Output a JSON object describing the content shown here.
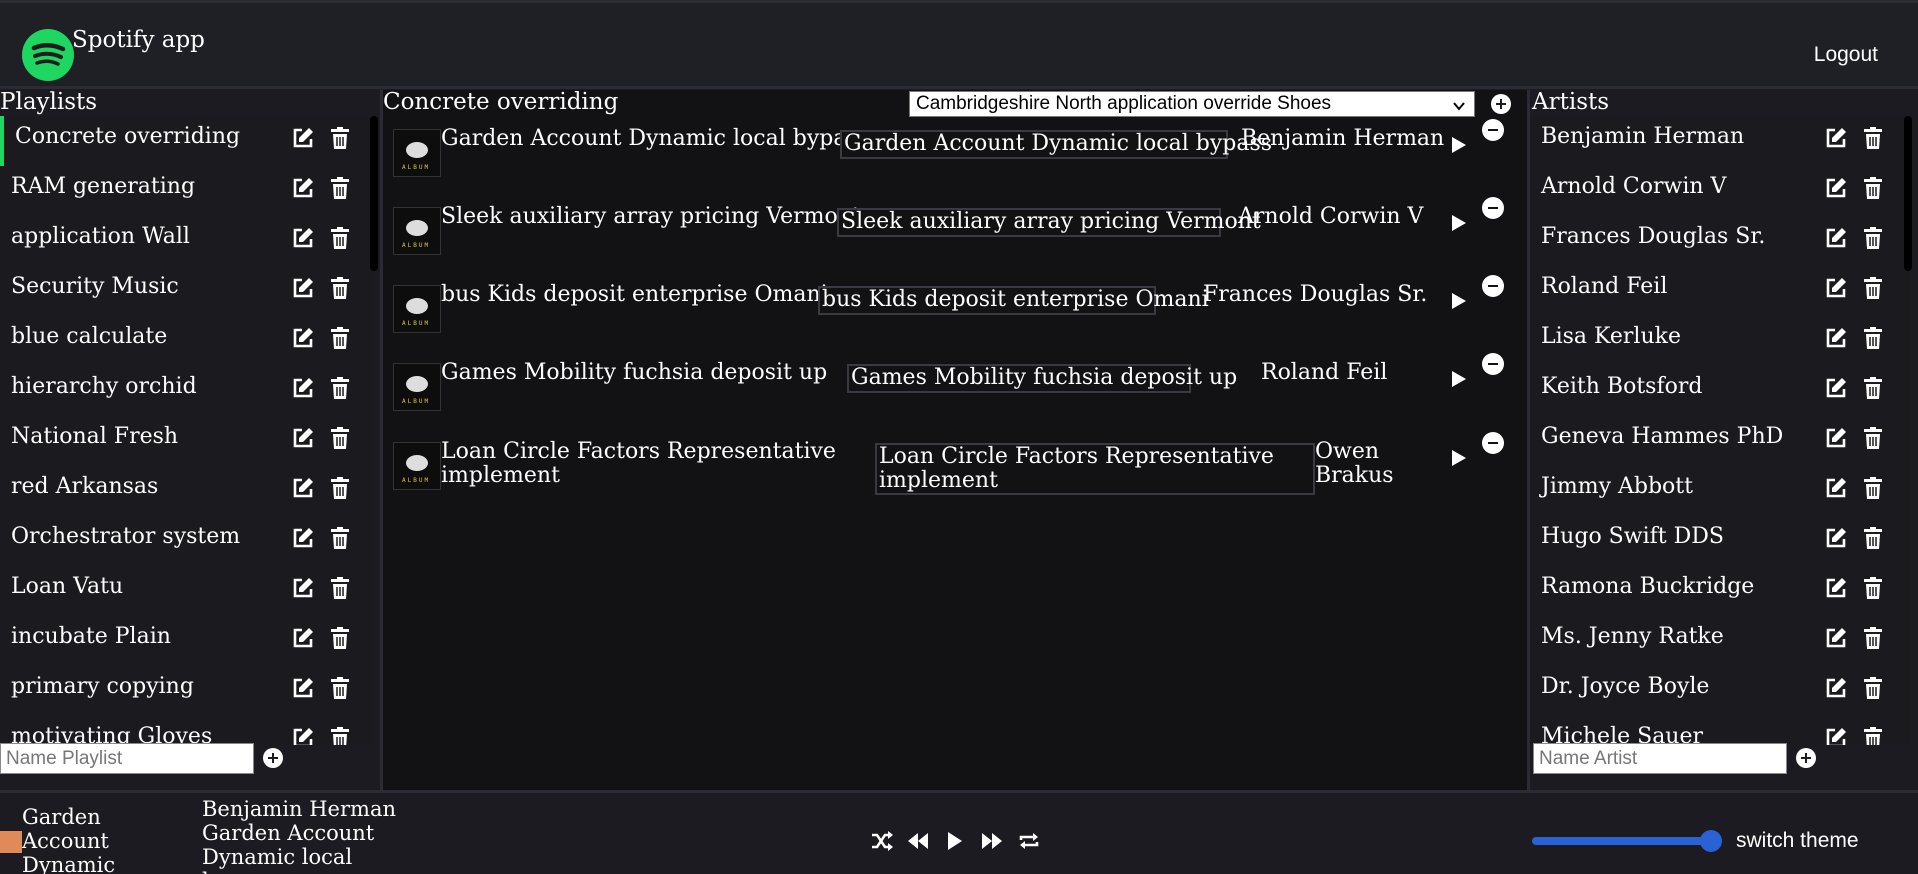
{
  "header": {
    "app_title": "Spotify app",
    "logout_label": "Logout"
  },
  "playlists": {
    "title": "Playlists",
    "items": [
      {
        "label": "Concrete overriding"
      },
      {
        "label": "RAM generating"
      },
      {
        "label": "application Wall"
      },
      {
        "label": "Security Music"
      },
      {
        "label": "blue calculate"
      },
      {
        "label": "hierarchy orchid"
      },
      {
        "label": "National Fresh"
      },
      {
        "label": "red Arkansas"
      },
      {
        "label": "Orchestrator system"
      },
      {
        "label": "Loan Vatu"
      },
      {
        "label": "incubate Plain"
      },
      {
        "label": "primary copying"
      },
      {
        "label": "motivating Gloves"
      }
    ],
    "input_placeholder": "Name Playlist"
  },
  "main": {
    "playlist_title": "Concrete overriding",
    "select_value": "Cambridgeshire North application override Shoes",
    "tracks": [
      {
        "title": "Garden Account Dynamic local bypass",
        "field": "Garden Account Dynamic local bypass",
        "artist": "Benjamin Herman",
        "cover_label": "ALBUM"
      },
      {
        "title": "Sleek auxiliary array pricing Vermont",
        "field": "Sleek auxiliary array pricing Vermont",
        "artist": "Arnold Corwin V",
        "cover_label": "ALBUM"
      },
      {
        "title": "bus Kids deposit enterprise Omani",
        "field": "bus Kids deposit enterprise Omani",
        "artist": "Frances Douglas Sr.",
        "cover_label": "ALBUM"
      },
      {
        "title": "Games Mobility fuchsia deposit up",
        "field": "Games Mobility fuchsia deposit up",
        "artist": "Roland Feil",
        "cover_label": "ALBUM"
      },
      {
        "title": "Loan Circle Factors Representative implement",
        "field": "Loan Circle Factors Representative implement",
        "artist": "Owen Brakus",
        "cover_label": "ALBUM"
      }
    ]
  },
  "artists": {
    "title": "Artists",
    "items": [
      {
        "label": "Benjamin Herman"
      },
      {
        "label": "Arnold Corwin V"
      },
      {
        "label": "Frances Douglas Sr."
      },
      {
        "label": "Roland Feil"
      },
      {
        "label": "Lisa Kerluke"
      },
      {
        "label": "Keith Botsford"
      },
      {
        "label": "Geneva Hammes PhD"
      },
      {
        "label": "Jimmy Abbott"
      },
      {
        "label": "Hugo Swift DDS"
      },
      {
        "label": "Ramona Buckridge"
      },
      {
        "label": "Ms. Jenny Ratke"
      },
      {
        "label": "Dr. Joyce Boyle"
      },
      {
        "label": "Michele Sauer"
      }
    ],
    "input_placeholder": "Name Artist"
  },
  "player": {
    "now_playing_title": "Garden Account Dynamic local bypass",
    "now_playing_artist": "Benjamin Herman",
    "now_playing_subtitle": "Garden Account Dynamic local bypass",
    "volume": 0.92,
    "switch_theme_label": "switch theme"
  },
  "colors": {
    "accent": "#1ed760",
    "volume": "#2a62d6",
    "background": "#1b1b21"
  }
}
